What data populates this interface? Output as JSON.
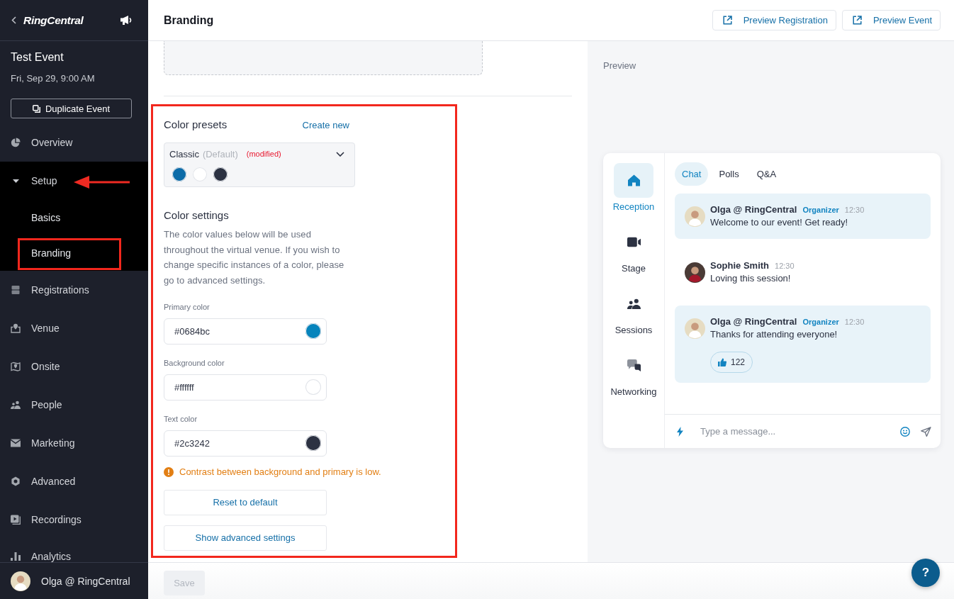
{
  "sidebar": {
    "logo": "RingCentral",
    "event_title": "Test Event",
    "event_date": "Fri, Sep 29, 9:00 AM",
    "duplicate_button": "Duplicate Event",
    "nav": [
      {
        "label": "Overview"
      },
      {
        "label": "Setup",
        "expanded": true,
        "arrow_pointer": true,
        "children": [
          {
            "label": "Basics",
            "highlighted": false
          },
          {
            "label": "Branding",
            "highlighted": true
          }
        ]
      },
      {
        "label": "Registrations"
      },
      {
        "label": "Venue"
      },
      {
        "label": "Onsite"
      },
      {
        "label": "People"
      },
      {
        "label": "Marketing"
      },
      {
        "label": "Advanced"
      },
      {
        "label": "Recordings"
      },
      {
        "label": "Analytics"
      }
    ],
    "user": "Olga @ RingCentral"
  },
  "header": {
    "title": "Branding",
    "buttons": [
      "Preview Registration",
      "Preview Event"
    ]
  },
  "editor": {
    "highlighted": true,
    "presets": {
      "title": "Color presets",
      "create_link": "Create new",
      "preset": {
        "name": "Classic",
        "default_tag": "(Default)",
        "modified_tag": "(modified)",
        "swatches": [
          {
            "color": "#0b6ba8"
          },
          {
            "color": "#ffffff"
          },
          {
            "color": "#2c3242"
          }
        ]
      }
    },
    "settings": {
      "title": "Color settings",
      "description": "The color values below will be used throughout the virtual venue. If you wish to change specific instances of a color, please go to advanced settings.",
      "fields": [
        {
          "label": "Primary color",
          "value": "#0684bc",
          "color": "#0684bc"
        },
        {
          "label": "Background color",
          "value": "#ffffff",
          "color": "#ffffff"
        },
        {
          "label": "Text color",
          "value": "#2c3242",
          "color": "#2c3242"
        }
      ],
      "warning": "Contrast between background and primary is low.",
      "buttons": [
        "Reset to default",
        "Show advanced settings"
      ]
    }
  },
  "save_button": {
    "label": "Save",
    "disabled": true
  },
  "preview": {
    "title": "Preview",
    "rooms": [
      {
        "label": "Reception",
        "selected": true
      },
      {
        "label": "Stage",
        "selected": false
      },
      {
        "label": "Sessions",
        "selected": false
      },
      {
        "label": "Networking",
        "selected": false
      }
    ],
    "tabs": [
      {
        "label": "Chat",
        "selected": true
      },
      {
        "label": "Polls",
        "selected": false
      },
      {
        "label": "Q&A",
        "selected": false
      }
    ],
    "messages": [
      {
        "author": "Olga @ RingCentral",
        "role": "Organizer",
        "time": "12:30",
        "text": "Welcome to our event! Get ready!",
        "highlighted": true
      },
      {
        "author": "Sophie Smith",
        "time": "12:30",
        "text": "Loving this session!",
        "highlighted": false
      },
      {
        "author": "Olga @ RingCentral",
        "role": "Organizer",
        "time": "12:30",
        "text": "Thanks for attending everyone!",
        "highlighted": true,
        "reaction": "122"
      }
    ],
    "composer": {
      "placeholder": "Type a message..."
    }
  },
  "help_button": "?"
}
